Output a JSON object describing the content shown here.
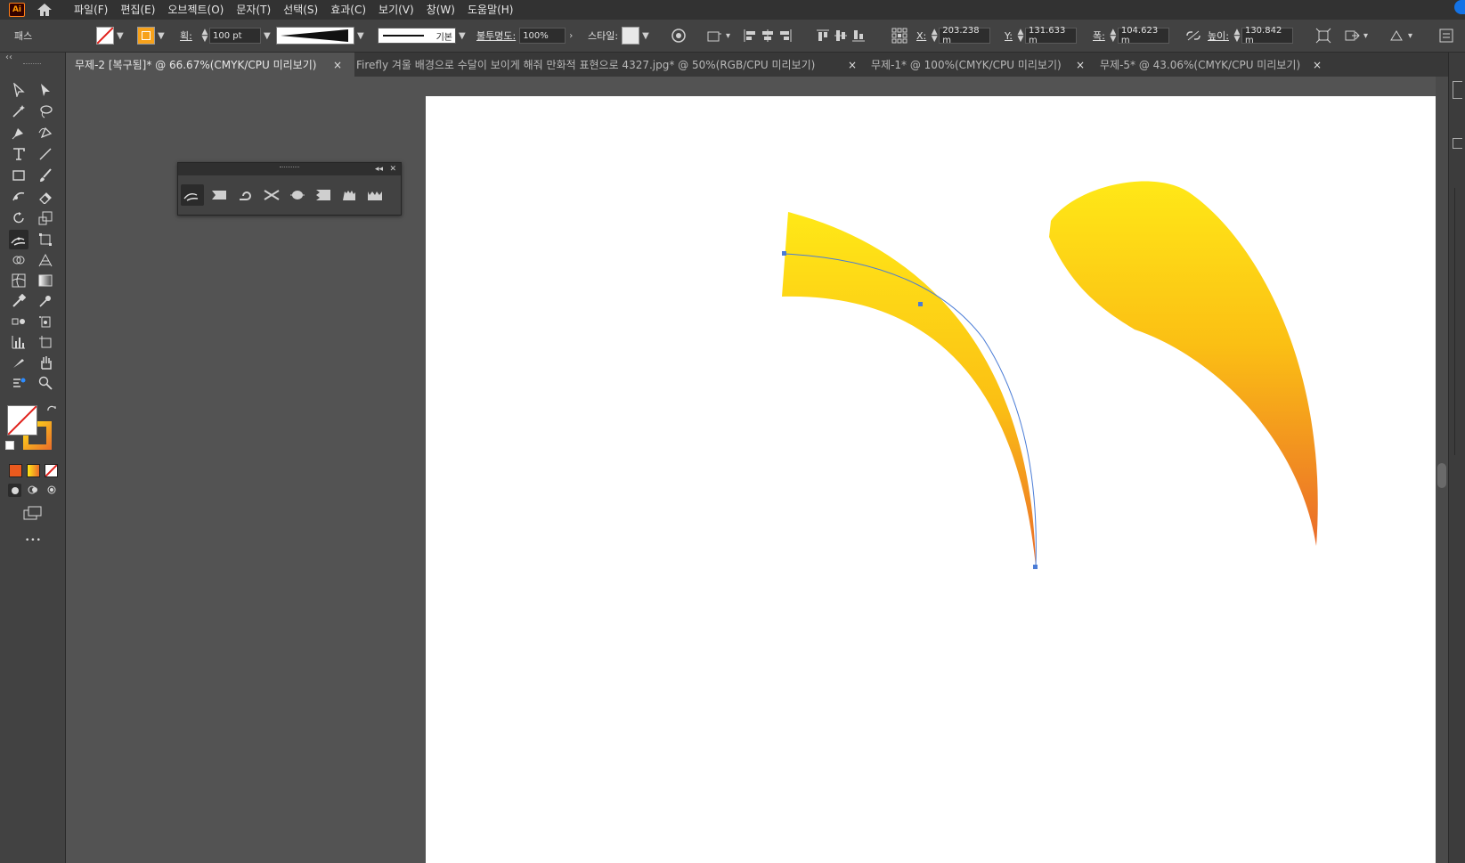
{
  "menu": {
    "app_logo": "Ai",
    "home_icon": "home-icon",
    "items": [
      "파일(F)",
      "편집(E)",
      "오브젝트(O)",
      "문자(T)",
      "선택(S)",
      "효과(C)",
      "보기(V)",
      "창(W)",
      "도움말(H)"
    ]
  },
  "control": {
    "selection_label": "패스",
    "stroke_label": "획:",
    "stroke_weight": "100 pt",
    "brush_label": "기본",
    "opacity_label": "불투명도:",
    "opacity_value": "100%",
    "style_label": "스타일:",
    "x_label": "X:",
    "x_value": "203.238 m",
    "y_label": "Y:",
    "y_value": "131.633 m",
    "w_label": "폭:",
    "w_value": "104.623 m",
    "h_label": "높이:",
    "h_value": "130.842 m"
  },
  "tabs": [
    {
      "label": "무제-2 [복구됨]* @ 66.67%(CMYK/CPU 미리보기)",
      "active": true
    },
    {
      "label": "Firefly 겨울 배경으로 수달이 보이게 해줘 만화적 표현으로 4327.jpg* @ 50%(RGB/CPU 미리보기)",
      "active": false
    },
    {
      "label": "무제-1* @ 100%(CMYK/CPU 미리보기)",
      "active": false
    },
    {
      "label": "무제-5* @ 43.06%(CMYK/CPU 미리보기)",
      "active": false
    }
  ],
  "tab_close": "×",
  "toolbar": {
    "collapse_label": "‹‹",
    "more_label": "•••"
  },
  "float_panel": {
    "collapse_label": "◂◂",
    "close_label": "✕"
  },
  "colors": {
    "fill_stroke_none": "#ffffff",
    "gradient_start": "#ffe817",
    "gradient_mid": "#fbbf14",
    "gradient_end": "#ea6a2a",
    "path_selection": "#4a7cd6"
  }
}
